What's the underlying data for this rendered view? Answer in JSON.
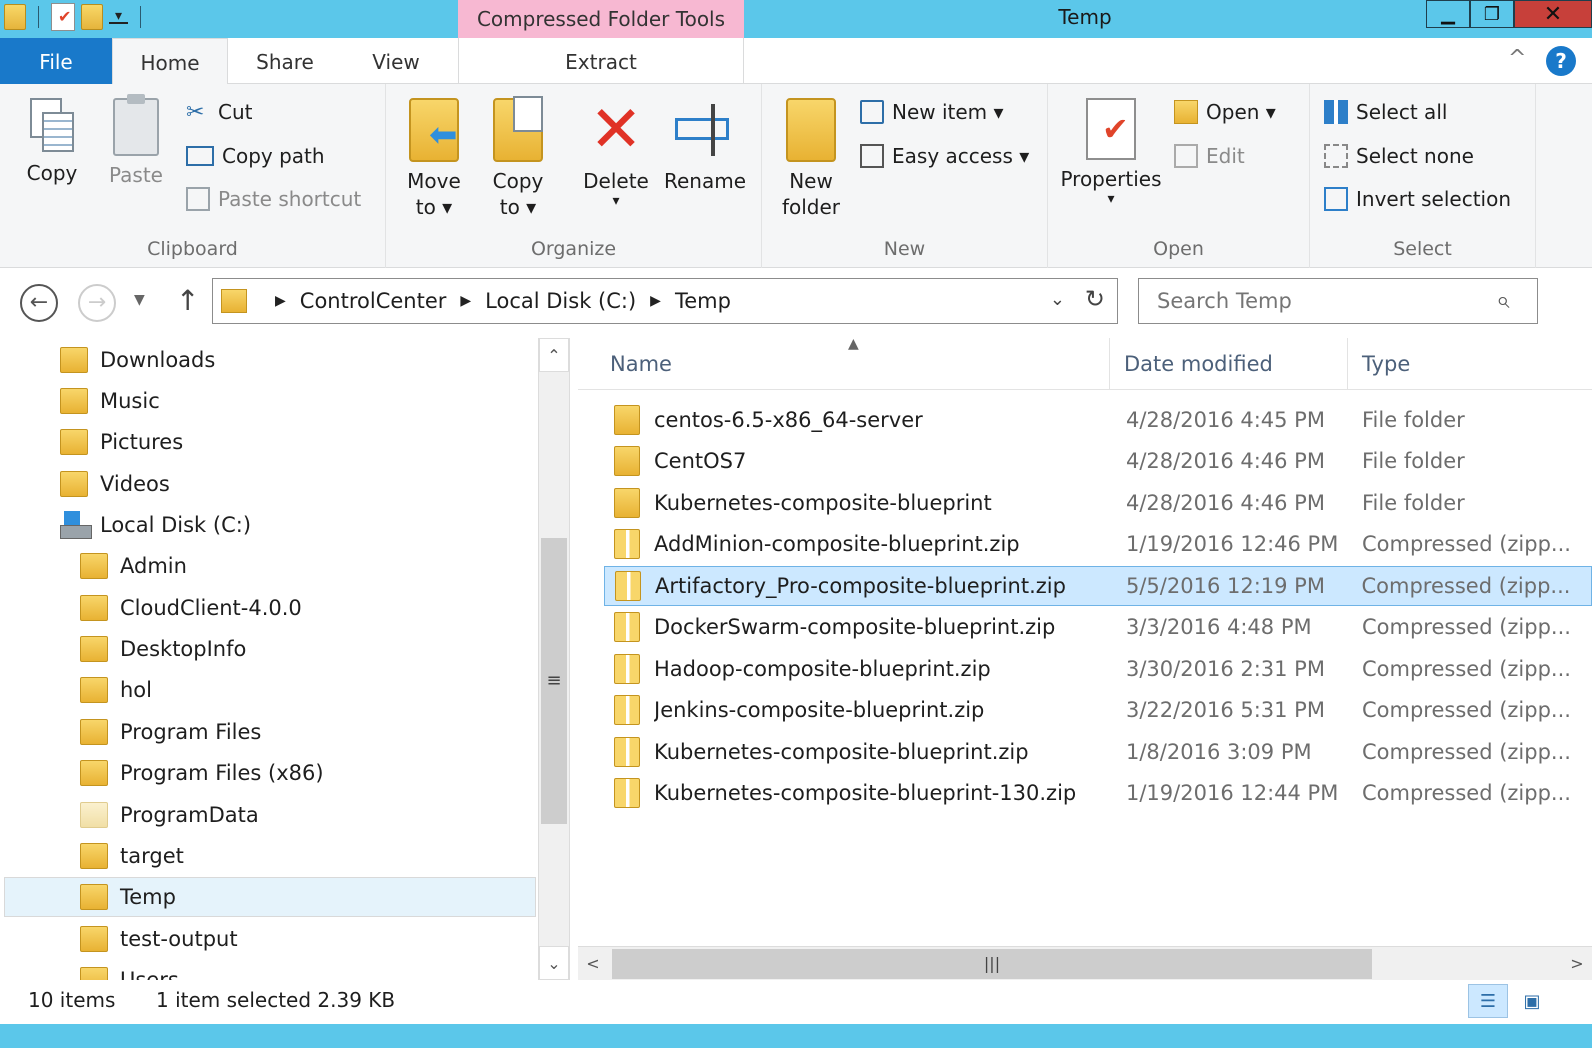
{
  "titlebar": {
    "context_tab_header": "Compressed Folder Tools",
    "window_title": "Temp",
    "minimize": "▁",
    "maximize": "❐",
    "close": "✕"
  },
  "ribbon_tabs": {
    "file": "File",
    "home": "Home",
    "share": "Share",
    "view": "View",
    "extract": "Extract",
    "help": "?"
  },
  "ribbon": {
    "clipboard": {
      "copy": "Copy",
      "paste": "Paste",
      "cut": "Cut",
      "copy_path": "Copy path",
      "paste_shortcut": "Paste shortcut",
      "label": "Clipboard"
    },
    "organize": {
      "move_to": "Move to ▾",
      "copy_to": "Copy to ▾",
      "delete": "Delete",
      "rename": "Rename",
      "label": "Organize"
    },
    "new": {
      "new_folder": "New folder",
      "new_item": "New item ▾",
      "easy_access": "Easy access ▾",
      "label": "New"
    },
    "open": {
      "properties": "Properties",
      "open": "Open ▾",
      "edit": "Edit",
      "label": "Open"
    },
    "select": {
      "select_all": "Select all",
      "select_none": "Select none",
      "invert_selection": "Invert selection",
      "label": "Select"
    }
  },
  "address": {
    "crumbs": [
      "ControlCenter",
      "Local Disk (C:)",
      "Temp"
    ],
    "search_placeholder": "Search Temp"
  },
  "nav_pane": {
    "items": [
      {
        "label": "Downloads",
        "icon": "downloads-folder-icon",
        "indent": 0
      },
      {
        "label": "Music",
        "icon": "music-folder-icon",
        "indent": 0
      },
      {
        "label": "Pictures",
        "icon": "pictures-folder-icon",
        "indent": 0
      },
      {
        "label": "Videos",
        "icon": "videos-folder-icon",
        "indent": 0
      },
      {
        "label": "Local Disk (C:)",
        "icon": "drive-icon",
        "indent": 0
      },
      {
        "label": "Admin",
        "icon": "folder-icon",
        "indent": 1
      },
      {
        "label": "CloudClient-4.0.0",
        "icon": "folder-icon",
        "indent": 1
      },
      {
        "label": "DesktopInfo",
        "icon": "folder-icon",
        "indent": 1
      },
      {
        "label": "hol",
        "icon": "folder-icon",
        "indent": 1
      },
      {
        "label": "Program Files",
        "icon": "folder-icon",
        "indent": 1
      },
      {
        "label": "Program Files (x86)",
        "icon": "folder-icon",
        "indent": 1
      },
      {
        "label": "ProgramData",
        "icon": "folder-icon",
        "indent": 1
      },
      {
        "label": "target",
        "icon": "folder-icon",
        "indent": 1
      },
      {
        "label": "Temp",
        "icon": "folder-icon",
        "indent": 1,
        "selected": true
      },
      {
        "label": "test-output",
        "icon": "folder-icon",
        "indent": 1
      },
      {
        "label": "Users",
        "icon": "folder-icon",
        "indent": 1
      }
    ]
  },
  "file_list": {
    "columns": {
      "name": "Name",
      "date": "Date modified",
      "type": "Type"
    },
    "rows": [
      {
        "name": "centos-6.5-x86_64-server",
        "date": "4/28/2016 4:45 PM",
        "type": "File folder",
        "kind": "folder"
      },
      {
        "name": "CentOS7",
        "date": "4/28/2016 4:46 PM",
        "type": "File folder",
        "kind": "folder"
      },
      {
        "name": "Kubernetes-composite-blueprint",
        "date": "4/28/2016 4:46 PM",
        "type": "File folder",
        "kind": "folder"
      },
      {
        "name": "AddMinion-composite-blueprint.zip",
        "date": "1/19/2016 12:46 PM",
        "type": "Compressed (zipp...",
        "kind": "zip"
      },
      {
        "name": "Artifactory_Pro-composite-blueprint.zip",
        "date": "5/5/2016 12:19 PM",
        "type": "Compressed (zipp...",
        "kind": "zip",
        "selected": true
      },
      {
        "name": "DockerSwarm-composite-blueprint.zip",
        "date": "3/3/2016 4:48 PM",
        "type": "Compressed (zipp...",
        "kind": "zip"
      },
      {
        "name": "Hadoop-composite-blueprint.zip",
        "date": "3/30/2016 2:31 PM",
        "type": "Compressed (zipp...",
        "kind": "zip"
      },
      {
        "name": "Jenkins-composite-blueprint.zip",
        "date": "3/22/2016 5:31 PM",
        "type": "Compressed (zipp...",
        "kind": "zip"
      },
      {
        "name": "Kubernetes-composite-blueprint.zip",
        "date": "1/8/2016 3:09 PM",
        "type": "Compressed (zipp...",
        "kind": "zip"
      },
      {
        "name": "Kubernetes-composite-blueprint-130.zip",
        "date": "1/19/2016 12:44 PM",
        "type": "Compressed (zipp...",
        "kind": "zip"
      }
    ]
  },
  "status": {
    "item_count": "10 items",
    "selection": "1 item selected  2.39 KB"
  },
  "colors": {
    "titlebar": "#5bc7ea",
    "file_tab": "#1979ca",
    "context_tab": "#f7b8d2",
    "selection": "#cce8ff"
  }
}
